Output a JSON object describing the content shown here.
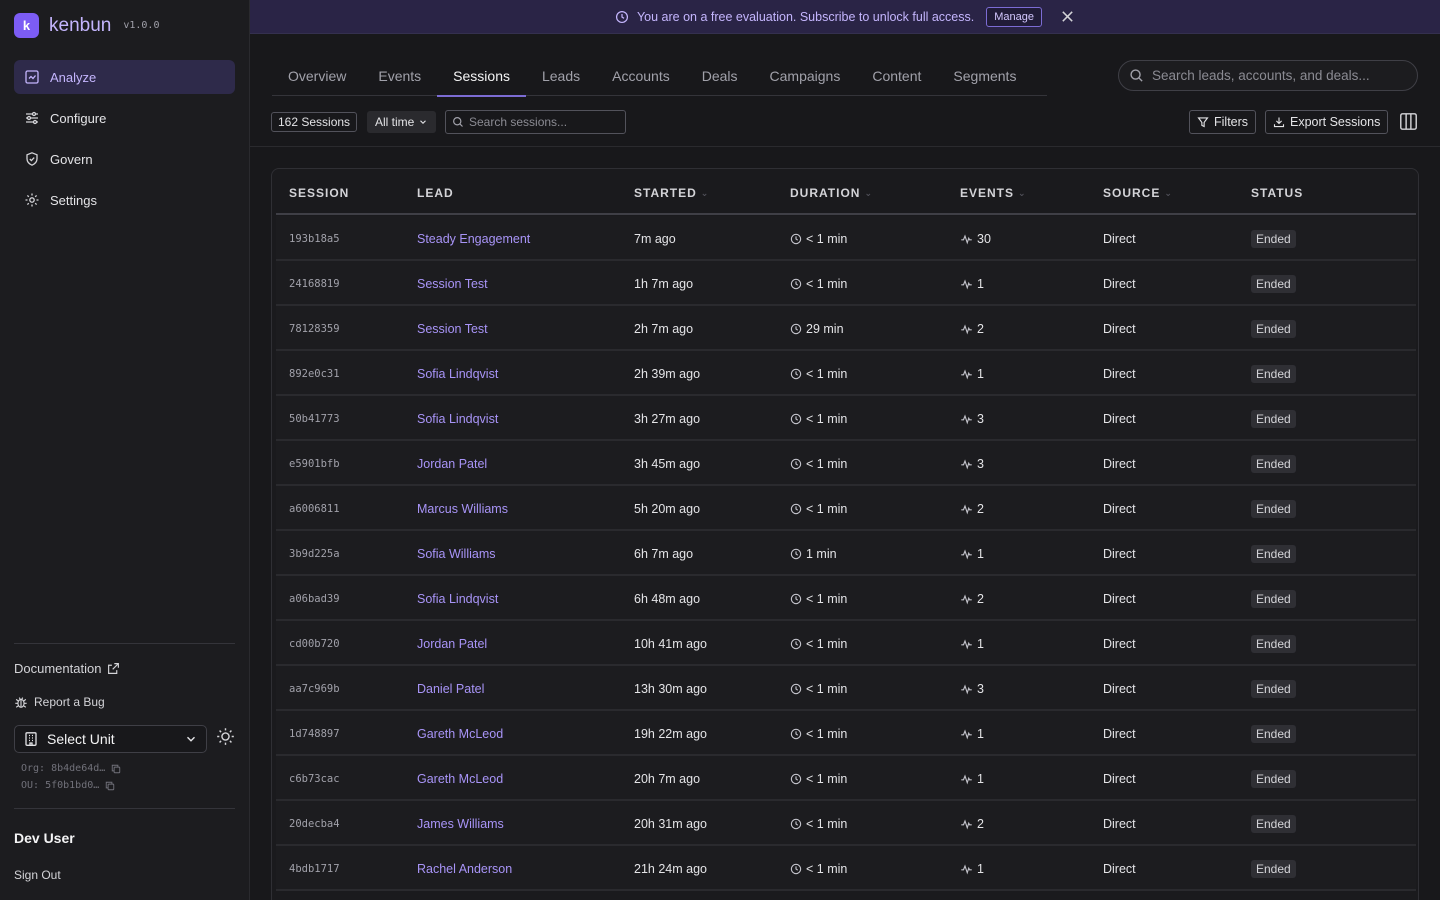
{
  "brand": {
    "name": "kenbun",
    "version": "v1.0.0",
    "logo_letter": "k"
  },
  "nav": [
    {
      "label": "Analyze",
      "icon": "analyze-icon",
      "active": true
    },
    {
      "label": "Configure",
      "icon": "sliders-icon",
      "active": false
    },
    {
      "label": "Govern",
      "icon": "shield-icon",
      "active": false
    },
    {
      "label": "Settings",
      "icon": "gear-icon",
      "active": false
    }
  ],
  "sidebar_footer": {
    "documentation": "Documentation",
    "report_bug": "Report a Bug",
    "select_unit": "Select Unit",
    "org": "Org: 8b4de64d…",
    "ou": "OU: 5f0b1bd0…",
    "user_name": "Dev User",
    "sign_out": "Sign Out"
  },
  "banner": {
    "message": "You are on a free evaluation. Subscribe to unlock full access.",
    "manage_label": "Manage"
  },
  "tabs": [
    {
      "label": "Overview",
      "active": false
    },
    {
      "label": "Events",
      "active": false
    },
    {
      "label": "Sessions",
      "active": true
    },
    {
      "label": "Leads",
      "active": false
    },
    {
      "label": "Accounts",
      "active": false
    },
    {
      "label": "Deals",
      "active": false
    },
    {
      "label": "Campaigns",
      "active": false
    },
    {
      "label": "Content",
      "active": false
    },
    {
      "label": "Segments",
      "active": false
    }
  ],
  "global_search": {
    "placeholder": "Search leads, accounts, and deals..."
  },
  "toolbar": {
    "count_label": "162 Sessions",
    "range_label": "All time",
    "search_placeholder": "Search sessions...",
    "filters_label": "Filters",
    "export_label": "Export Sessions"
  },
  "table": {
    "columns": [
      "SESSION",
      "LEAD",
      "STARTED",
      "DURATION",
      "EVENTS",
      "SOURCE",
      "STATUS"
    ],
    "rows": [
      {
        "session": "193b18a5",
        "lead": "Steady Engagement",
        "started": "7m ago",
        "duration": "< 1 min",
        "events": "30",
        "source": "Direct",
        "status": "Ended"
      },
      {
        "session": "24168819",
        "lead": "Session Test",
        "started": "1h 7m ago",
        "duration": "< 1 min",
        "events": "1",
        "source": "Direct",
        "status": "Ended"
      },
      {
        "session": "78128359",
        "lead": "Session Test",
        "started": "2h 7m ago",
        "duration": "29 min",
        "events": "2",
        "source": "Direct",
        "status": "Ended"
      },
      {
        "session": "892e0c31",
        "lead": "Sofia Lindqvist",
        "started": "2h 39m ago",
        "duration": "< 1 min",
        "events": "1",
        "source": "Direct",
        "status": "Ended"
      },
      {
        "session": "50b41773",
        "lead": "Sofia Lindqvist",
        "started": "3h 27m ago",
        "duration": "< 1 min",
        "events": "3",
        "source": "Direct",
        "status": "Ended"
      },
      {
        "session": "e5901bfb",
        "lead": "Jordan Patel",
        "started": "3h 45m ago",
        "duration": "< 1 min",
        "events": "3",
        "source": "Direct",
        "status": "Ended"
      },
      {
        "session": "a6006811",
        "lead": "Marcus Williams",
        "started": "5h 20m ago",
        "duration": "< 1 min",
        "events": "2",
        "source": "Direct",
        "status": "Ended"
      },
      {
        "session": "3b9d225a",
        "lead": "Sofia Williams",
        "started": "6h 7m ago",
        "duration": "1 min",
        "events": "1",
        "source": "Direct",
        "status": "Ended"
      },
      {
        "session": "a06bad39",
        "lead": "Sofia Lindqvist",
        "started": "6h 48m ago",
        "duration": "< 1 min",
        "events": "2",
        "source": "Direct",
        "status": "Ended"
      },
      {
        "session": "cd00b720",
        "lead": "Jordan Patel",
        "started": "10h 41m ago",
        "duration": "< 1 min",
        "events": "1",
        "source": "Direct",
        "status": "Ended"
      },
      {
        "session": "aa7c969b",
        "lead": "Daniel Patel",
        "started": "13h 30m ago",
        "duration": "< 1 min",
        "events": "3",
        "source": "Direct",
        "status": "Ended"
      },
      {
        "session": "1d748897",
        "lead": "Gareth McLeod",
        "started": "19h 22m ago",
        "duration": "< 1 min",
        "events": "1",
        "source": "Direct",
        "status": "Ended"
      },
      {
        "session": "c6b73cac",
        "lead": "Gareth McLeod",
        "started": "20h 7m ago",
        "duration": "< 1 min",
        "events": "1",
        "source": "Direct",
        "status": "Ended"
      },
      {
        "session": "20decba4",
        "lead": "James Williams",
        "started": "20h 31m ago",
        "duration": "< 1 min",
        "events": "2",
        "source": "Direct",
        "status": "Ended"
      },
      {
        "session": "4bdb1717",
        "lead": "Rachel Anderson",
        "started": "21h 24m ago",
        "duration": "< 1 min",
        "events": "1",
        "source": "Direct",
        "status": "Ended"
      }
    ]
  },
  "colors": {
    "accent": "#7c5cf4",
    "lead_link": "#a894f7",
    "banner_bg": "#2a2446"
  }
}
